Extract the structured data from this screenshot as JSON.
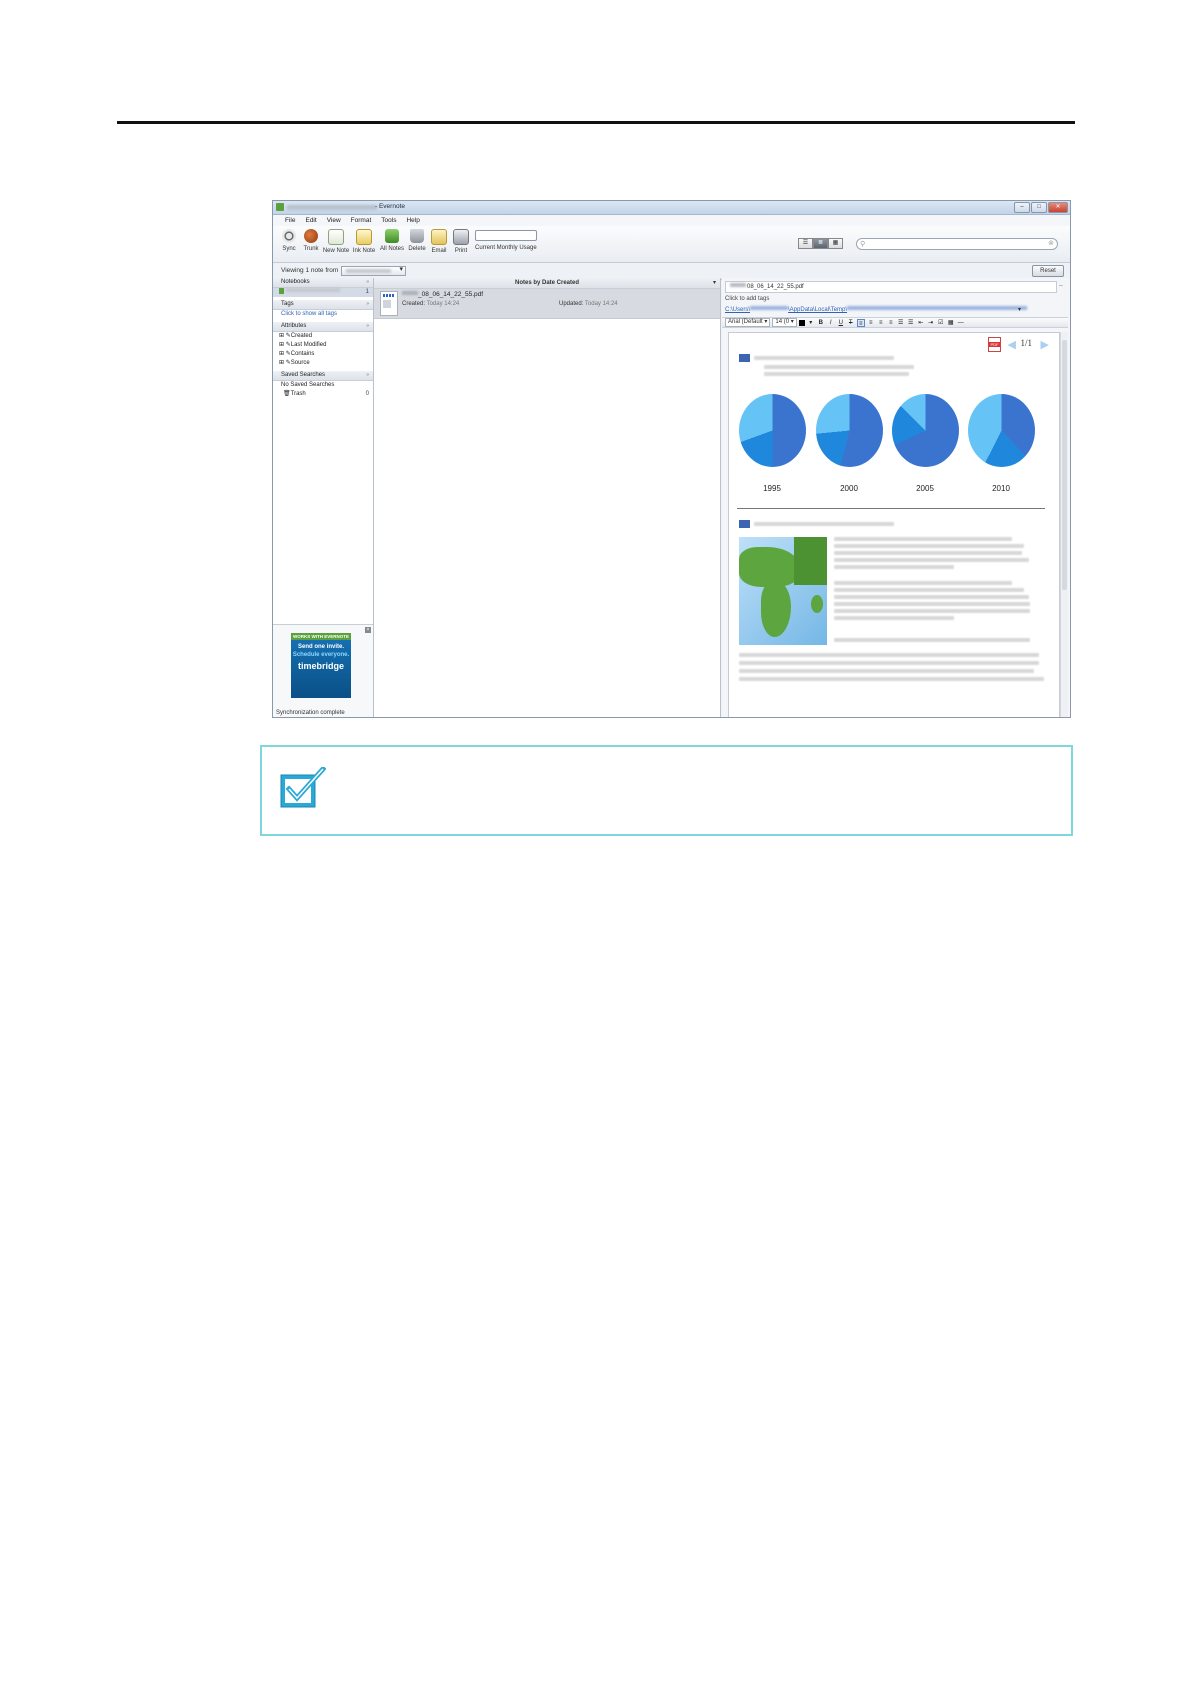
{
  "window": {
    "title": "- Evernote",
    "controls": {
      "minimize": "–",
      "maximize": "□",
      "close": "✕"
    }
  },
  "menu": [
    "File",
    "Edit",
    "View",
    "Format",
    "Tools",
    "Help"
  ],
  "toolbar": {
    "buttons": [
      {
        "label": "Sync",
        "icon": "sync-icon"
      },
      {
        "label": "Trunk",
        "icon": "trunk-icon"
      },
      {
        "label": "New Note",
        "icon": "new-note-icon"
      },
      {
        "label": "Ink Note",
        "icon": "ink-note-icon"
      },
      {
        "label": "All Notes",
        "icon": "all-notes-icon"
      },
      {
        "label": "Delete",
        "icon": "trash-icon"
      },
      {
        "label": "Email",
        "icon": "email-icon"
      },
      {
        "label": "Print",
        "icon": "printer-icon"
      }
    ],
    "usage_label": "Current Monthly Usage",
    "view_modes": [
      "☰",
      "≣",
      "▦"
    ],
    "search_placeholder": ""
  },
  "viewbar": {
    "label": "Viewing 1 note from",
    "reset": "Reset"
  },
  "sidebar": {
    "notebooks": {
      "header": "Notebooks",
      "count": "1"
    },
    "tags": {
      "header": "Tags",
      "link": "Click to show all tags"
    },
    "attributes": {
      "header": "Attributes",
      "items": [
        "Created",
        "Last Modified",
        "Contains",
        "Source"
      ]
    },
    "saved_searches": {
      "header": "Saved Searches",
      "empty": "No Saved Searches"
    },
    "trash": {
      "label": "Trash",
      "count": "0"
    },
    "ad": {
      "strip": "WORKS WITH EVERNOTE",
      "line1": "Send one invite.",
      "line2": "Schedule everyone.",
      "brand": "timebridge"
    },
    "status": "Synchronization complete"
  },
  "note_list": {
    "header": "Notes by Date Created",
    "note": {
      "title": "_08_06_14_22_55.pdf",
      "created_label": "Created:",
      "created_value": "Today 14:24",
      "updated_label": "Updated:",
      "updated_value": "Today 14:24"
    }
  },
  "editor": {
    "title": "08_06_14_22_55.pdf",
    "tags_placeholder": "Click to add tags",
    "path": {
      "prefix": "C:\\Users\\",
      "middle": "\\AppData\\Local\\Temp\\"
    },
    "font": "Arial (Default",
    "size": "14 (0",
    "format_buttons": [
      "B",
      "I",
      "U",
      "T",
      "≡",
      "≡",
      "≡",
      "≡",
      "☰",
      "☰",
      "⇤",
      "⇥",
      "☑",
      "▦",
      "—"
    ],
    "pdf": {
      "page_indicator": "1/1",
      "years": [
        "1995",
        "2000",
        "2005",
        "2010"
      ],
      "pie_fractions": [
        0.5,
        0.54,
        0.68,
        0.38
      ]
    }
  }
}
